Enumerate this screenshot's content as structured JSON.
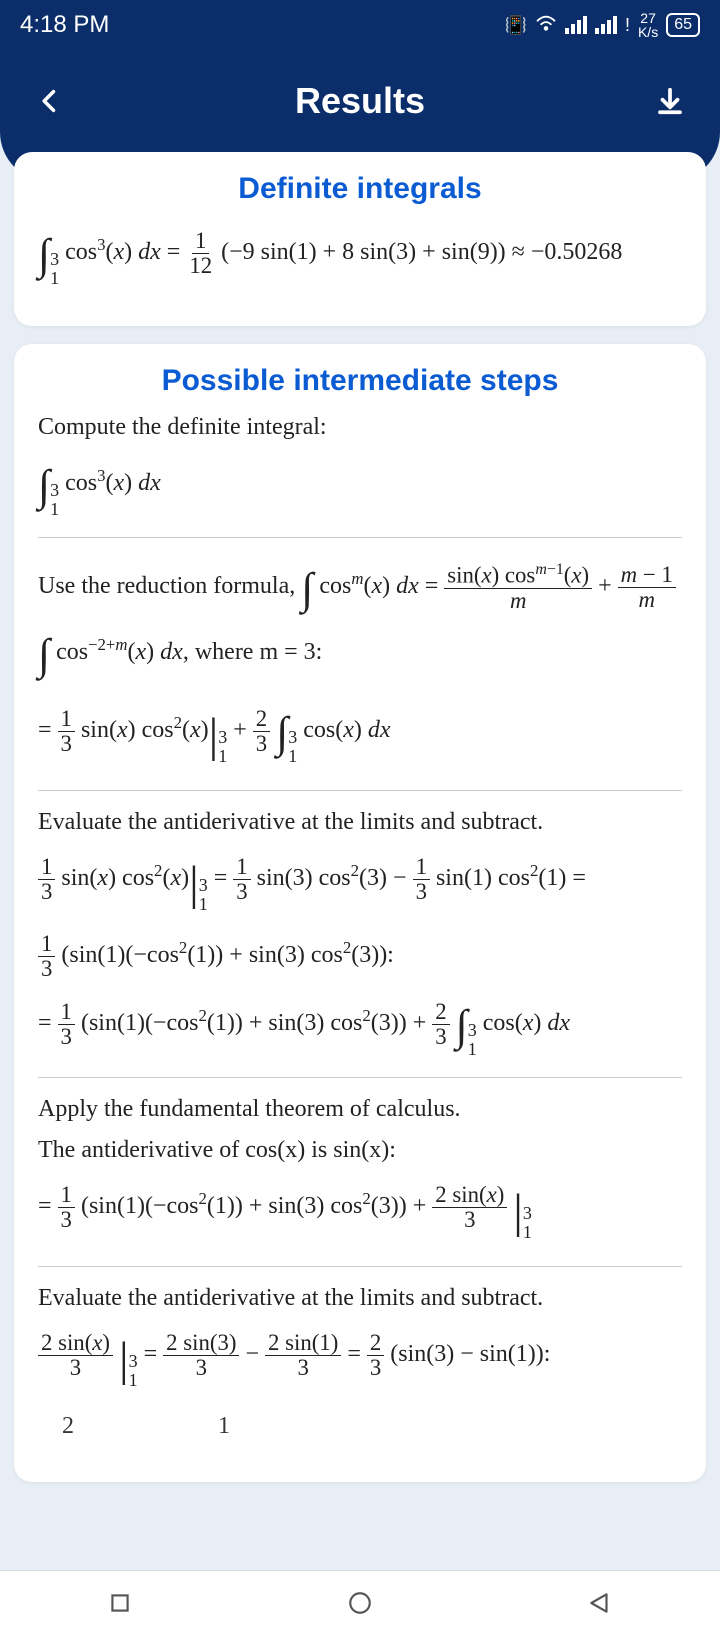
{
  "status": {
    "time": "4:18 PM",
    "net_top": "27",
    "net_bot": "K/s",
    "battery": "65"
  },
  "header": {
    "title": "Results"
  },
  "section1": {
    "title": "Definite integrals",
    "formula_rhs": "(−9 sin(1) + 8 sin(3) + sin(9)) ≈ −0.50268"
  },
  "section2": {
    "title": "Possible intermediate steps",
    "intro1": "Compute the definite integral:",
    "step1a": "Use the reduction formula, ",
    "step1c": ", where m = 3:",
    "step2a": "Evaluate the antiderivative at the limits and subtract.",
    "step3a": "Apply the fundamental theorem of calculus.",
    "step3b": "The antiderivative of cos(x) is sin(x):",
    "step4a": "Evaluate the antiderivative at the limits and subtract."
  }
}
